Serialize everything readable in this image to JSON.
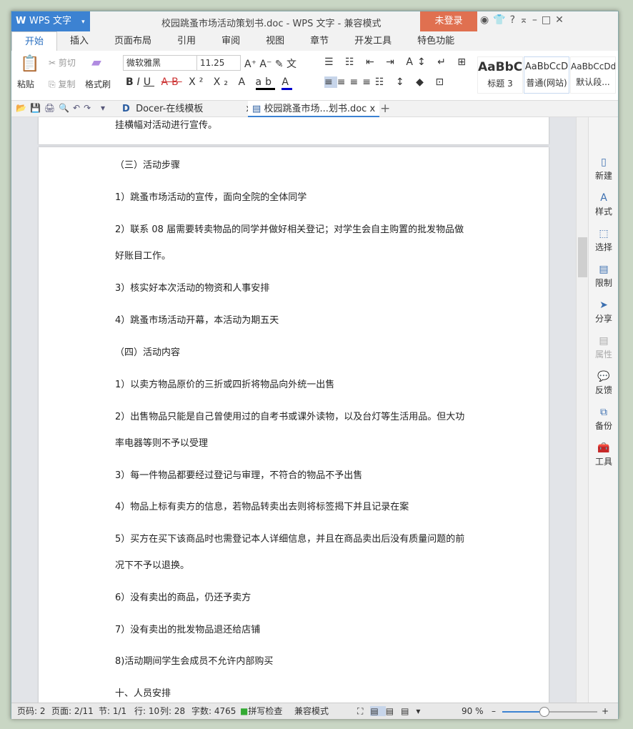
{
  "app": {
    "name": "WPS 文字",
    "title": "校园跳蚤市场活动策划书.doc - WPS 文字 - 兼容模式",
    "login": "未登录"
  },
  "tabs": [
    "开始",
    "插入",
    "页面布局",
    "引用",
    "审阅",
    "视图",
    "章节",
    "开发工具",
    "特色功能"
  ],
  "ribbon": {
    "paste": "粘贴",
    "cut": "剪切",
    "copy": "复制",
    "format_painter": "格式刷",
    "font": "微软雅黑",
    "size": "11.25",
    "styles": [
      {
        "preview": "AaBbC",
        "label": "标题 3"
      },
      {
        "preview": "AaBbCcD",
        "label": "普通(网站)"
      },
      {
        "preview": "AaBbCcDd",
        "label": "默认段..."
      }
    ]
  },
  "doc_tabs": [
    {
      "label": "Docer-在线模板"
    },
    {
      "label": "校园跳蚤市场...划书.doc"
    }
  ],
  "document": {
    "prev_line": "挂横幅对活动进行宣传。",
    "lines": [
      "（三）活动步骤",
      "1）跳蚤市场活动的宣传，面向全院的全体同学",
      "2）联系 08 届需要转卖物品的同学并做好相关登记；对学生会自主购置的批发物品做",
      "好账目工作。",
      "3）核实好本次活动的物资和人事安排",
      "4）跳蚤市场活动开幕，本活动为期五天",
      "（四）活动内容",
      "1）以卖方物品原价的三折或四折将物品向外统一出售",
      "2）出售物品只能是自己曾使用过的自考书或课外读物，以及台灯等生活用品。但大功",
      "率电器等则不予以受理",
      "3）每一件物品都要经过登记与审理，不符合的物品不予出售",
      "4）物品上标有卖方的信息，若物品转卖出去则将标签揭下并且记录在案",
      "5）买方在买下该商品时也需登记本人详细信息，并且在商品卖出后没有质量问题的前",
      "况下不予以退换。",
      "6）没有卖出的商品，仍还予卖方",
      "7）没有卖出的批发物品退还给店铺",
      "8)活动期间学生会成员不允许内部购买",
      "十、人员安排"
    ]
  },
  "side_panel": [
    "新建",
    "样式",
    "选择",
    "限制",
    "分享",
    "属性",
    "反馈",
    "备份",
    "工具"
  ],
  "status": {
    "page_no": "页码: 2",
    "pages": "页面: 2/11",
    "section": "节: 1/1",
    "row": "行: 10",
    "col": "列: 28",
    "words": "字数: 4765",
    "spell": "拼写检查",
    "mode": "兼容模式",
    "zoom": "90 %",
    "zoom_value": 90
  }
}
